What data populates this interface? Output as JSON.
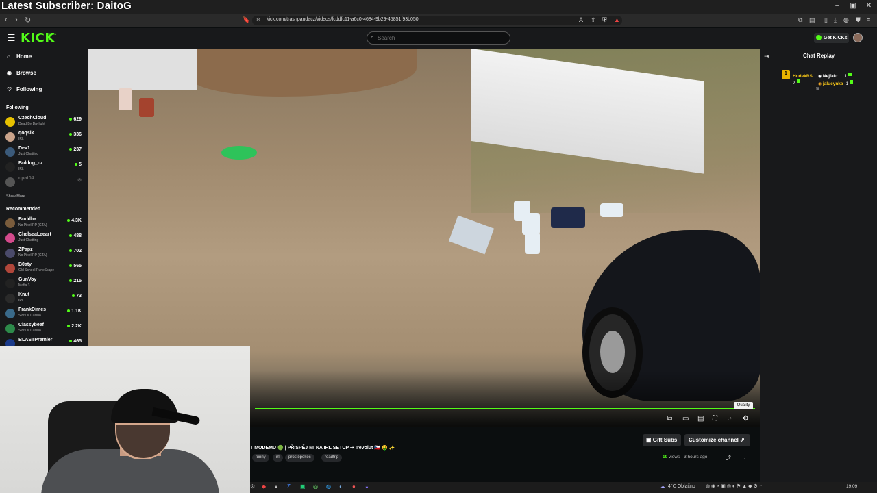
{
  "overlay": {
    "latest_subscriber": "Latest Subscriber: DaitoG"
  },
  "browser": {
    "url": "kick.com/trashpandacz/videos/fcddfc11-a6c0-4684-9b29-45851f93b050",
    "back_icon": "arrow-left-icon",
    "forward_icon": "arrow-right-icon",
    "reload_icon": "reload-icon"
  },
  "header": {
    "logo": "KICK",
    "logo_badge": "BETA",
    "search_placeholder": "Search",
    "get_kicks_label": "Get KICKs",
    "brand_color": "#53fc18"
  },
  "sidebar": {
    "nav": [
      {
        "icon": "home-icon",
        "label": "Home"
      },
      {
        "icon": "compass-icon",
        "label": "Browse"
      },
      {
        "icon": "heart-icon",
        "label": "Following"
      }
    ],
    "following_heading": "Following",
    "following": [
      {
        "name": "CzechCloud",
        "game": "Dead By Daylight",
        "viewers": "629",
        "avatar_color": "#e8c200"
      },
      {
        "name": "qoqsik",
        "game": "IRL",
        "viewers": "336",
        "avatar_color": "#caa38a"
      },
      {
        "name": "Dev1",
        "game": "Just Chatting",
        "viewers": "237",
        "avatar_color": "#3b5a7a"
      },
      {
        "name": "Buldog_cz",
        "game": "IRL",
        "viewers": "5",
        "avatar_color": "#222222"
      },
      {
        "name": "opat04",
        "game": "",
        "viewers": "",
        "avatar_color": "#555555"
      }
    ],
    "show_more": "Show More",
    "recommended_heading": "Recommended",
    "recommended": [
      {
        "name": "Buddha",
        "game": "No Pixel RP (GTA)",
        "viewers": "4.3K",
        "avatar_color": "#7a5c3c"
      },
      {
        "name": "ChelseaLeeart",
        "game": "Just Chatting",
        "viewers": "488",
        "avatar_color": "#d44a8c"
      },
      {
        "name": "ZPapz",
        "game": "No Pixel RP (GTA)",
        "viewers": "702",
        "avatar_color": "#4a4a6a"
      },
      {
        "name": "B0aty",
        "game": "Old School RuneScape",
        "viewers": "565",
        "avatar_color": "#b0463a"
      },
      {
        "name": "GunVoy",
        "game": "Mafia 3",
        "viewers": "215",
        "avatar_color": "#222222"
      },
      {
        "name": "Knut",
        "game": "IRL",
        "viewers": "73",
        "avatar_color": "#2a2a2a"
      },
      {
        "name": "FrankDimes",
        "game": "Slots & Casino",
        "viewers": "1.1K",
        "avatar_color": "#3a6a8a"
      },
      {
        "name": "Classybeef",
        "game": "Slots & Casino",
        "viewers": "2.2K",
        "avatar_color": "#2d8a4a"
      },
      {
        "name": "BLASTPremier",
        "game": "",
        "viewers": "465",
        "avatar_color": "#1a3a8a"
      }
    ]
  },
  "player": {
    "progress": 1.0,
    "tooltip": "Quality",
    "controls": [
      "pip-icon",
      "theater-icon",
      "miniplayer-icon",
      "fullscreen-icon",
      "speed-icon",
      "gear-icon"
    ]
  },
  "video_info": {
    "title": "T MODEMU 🟢 | PŘISPĚJ MI NA IRL SETUP ➞ !revolut 🇨🇿 🤑 ✨",
    "tags": [
      "funny",
      "irl",
      "prostěpokec",
      "roadtrip"
    ],
    "gift_subs": "Gift Subs",
    "customize_channel": "Customize channel",
    "views_count": "19",
    "views_label": " views",
    "age": "3 hours ago"
  },
  "chat": {
    "title": "Chat Replay",
    "gifter_rank": "1",
    "gifters": [
      {
        "name": "HudekRS",
        "count": "2",
        "color": "#f5c518"
      },
      {
        "name": "Nejfakt",
        "count": "1",
        "color": "#ffffff"
      },
      {
        "name": "jalucynka",
        "count": "1",
        "color": "#f5c518"
      }
    ]
  },
  "taskbar": {
    "weather": "4°C Oblačno",
    "time": "19:09"
  }
}
